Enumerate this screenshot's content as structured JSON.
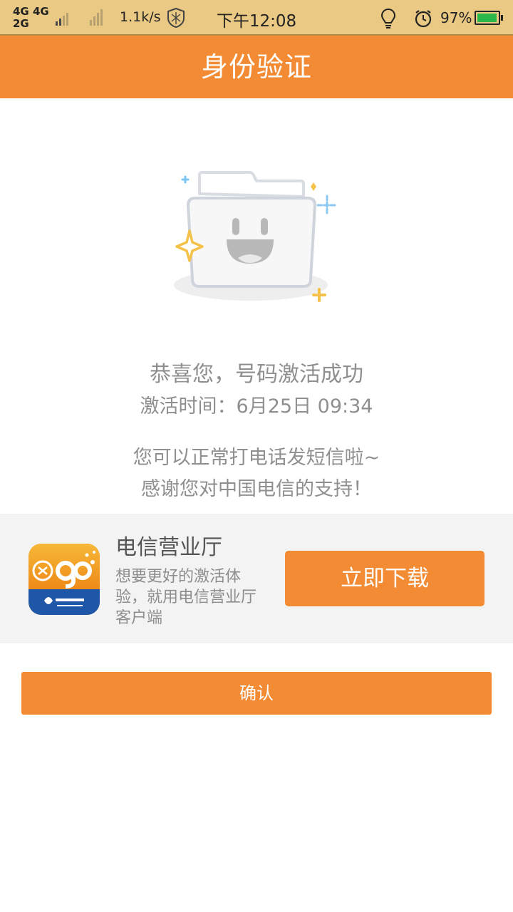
{
  "status_bar": {
    "net_row1": "4G 4G",
    "net_row2": "2G",
    "speed": "1.1k/s",
    "time": "下午12:08",
    "battery_pct": "97%",
    "battery_level": 0.97,
    "icons": [
      "vpn-shield-icon",
      "bulb-icon",
      "alarm-icon",
      "battery-icon"
    ]
  },
  "header": {
    "title": "身份验证"
  },
  "illustration": {
    "icon": "smiling-folder-icon"
  },
  "message": {
    "title": "恭喜您，号码激活成功",
    "time": "激活时间：6月25日 09:34",
    "line1": "您可以正常打电话发短信啦~",
    "line2": "感谢您对中国电信的支持！"
  },
  "promo": {
    "app_name": "电信营业厅",
    "description": "想要更好的激活体验，就用电信营业厅客户端",
    "download_label": "立即下载",
    "icon": "huango-app-icon"
  },
  "confirm_label": "确认",
  "colors": {
    "accent": "#f28b33",
    "text_gray": "#8f8f8f",
    "status_bg": "#e9c983"
  }
}
